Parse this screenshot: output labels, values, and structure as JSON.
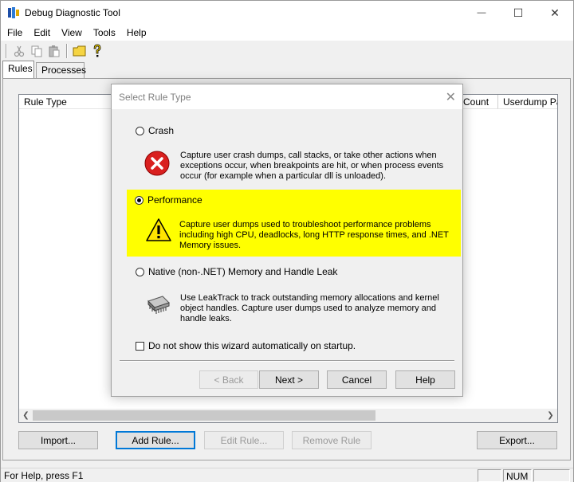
{
  "window": {
    "title": "Debug Diagnostic Tool",
    "minimize_glyph": "—",
    "maximize_glyph": "☐",
    "close_glyph": "✕"
  },
  "menu": [
    "File",
    "Edit",
    "View",
    "Tools",
    "Help"
  ],
  "toolbar": {
    "icons": [
      "cut-icon",
      "copy-icon",
      "paste-icon",
      "open-folder-icon",
      "help-cursor-icon"
    ]
  },
  "tabs": [
    {
      "label": "Rules",
      "active": true
    },
    {
      "label": "Processes",
      "active": false
    }
  ],
  "list": {
    "columns": [
      "Rule Type",
      "Count",
      "Userdump Pat"
    ]
  },
  "buttons": {
    "import": "Import...",
    "add_rule": "Add Rule...",
    "edit_rule": "Edit Rule...",
    "remove_rule": "Remove Rule",
    "export": "Export..."
  },
  "status": {
    "help_text": "For Help, press F1",
    "num": "NUM"
  },
  "dialog": {
    "title": "Select Rule Type",
    "close_glyph": "✕",
    "options": [
      {
        "label": "Crash",
        "selected": false,
        "icon": "error-icon",
        "description": "Capture user crash dumps, call stacks, or take other actions when exceptions occur, when breakpoints are hit, or when process events occur (for example when a particular dll is unloaded)."
      },
      {
        "label": "Performance",
        "selected": true,
        "icon": "warning-icon",
        "description": "Capture user dumps used to troubleshoot performance problems including high CPU, deadlocks, long HTTP response times, and .NET Memory issues."
      },
      {
        "label": "Native (non-.NET) Memory and Handle Leak",
        "selected": false,
        "icon": "memory-chip-icon",
        "description": "Use LeakTrack to track outstanding memory allocations and kernel object handles. Capture user dumps used to analyze memory and handle leaks."
      }
    ],
    "checkbox_label": "Do not show this wizard automatically on startup.",
    "checkbox_checked": false,
    "buttons": {
      "back": "< Back",
      "next": "Next >",
      "cancel": "Cancel",
      "help": "Help"
    },
    "highlight_color": "#ffff00"
  }
}
